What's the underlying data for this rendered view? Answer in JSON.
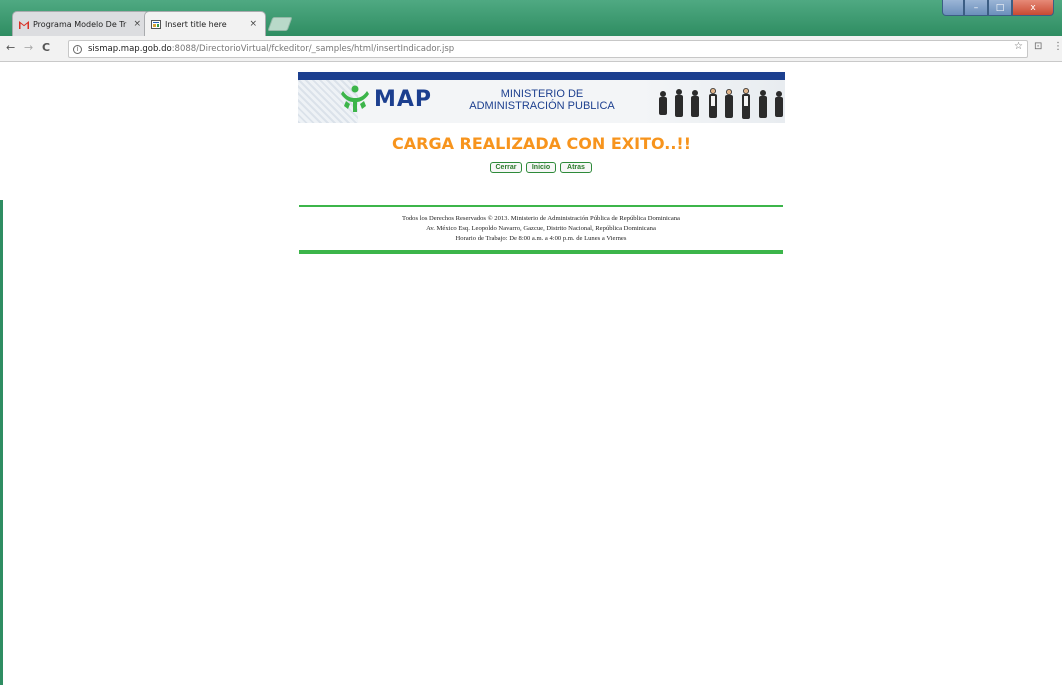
{
  "browser": {
    "tabs": [
      {
        "title": "Programa Modelo De Tr",
        "icon": "gmail-icon",
        "active": false
      },
      {
        "title": "Insert title here",
        "icon": "page-icon",
        "active": true
      }
    ],
    "tab_close": "×",
    "window_controls": {
      "minimize": "–",
      "maximize": "□",
      "close": "x"
    },
    "address": {
      "host": "sismap.map.gob.do",
      "path": ":8088/DirectorioVirtual/fckeditor/_samples/html/insertIndicador.jsp"
    },
    "nav": {
      "back": "←",
      "forward": "→",
      "reload": "C"
    },
    "star": "☆",
    "ext": "⊡",
    "menu": "⋮"
  },
  "header": {
    "logo_text": "MAP",
    "ministerio_line1": "MINISTERIO DE",
    "ministerio_line2": "ADMINISTRACIÓN PUBLICA"
  },
  "message": "CARGA REALIZADA CON EXITO..!!",
  "buttons": {
    "cerrar": "Cerrar",
    "inicio": "Inicio",
    "atras": "Atras"
  },
  "footer": {
    "line1": "Todos los Derechos Reservados © 2013. Ministerio de Administración Pública de República Dominicana",
    "line2": "Av. México Esq. Leopoldo Navarro, Gazcue, Distrito Nacional, República Dominicana",
    "line3": "Horario de Trabajo: De 8:00 a.m. a 4:00 p.m. de Lunes a Viernes"
  },
  "colors": {
    "brand_blue": "#1c3f8f",
    "accent_orange": "#f7941d",
    "brand_green": "#3cb54a"
  }
}
